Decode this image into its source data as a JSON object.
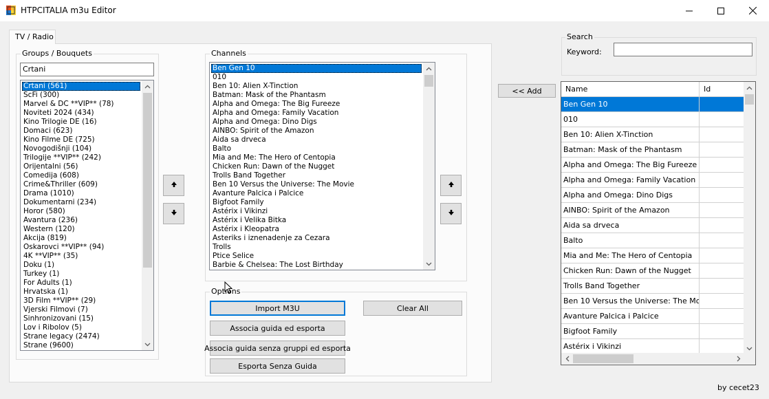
{
  "window": {
    "title": "HTPCITALIA m3u Editor",
    "icon": "app-icon",
    "minimize_glyph": "—",
    "maximize_glyph": "☐",
    "close_glyph": "✕"
  },
  "tab": {
    "label": "TV / Radio"
  },
  "groups": {
    "legend": "Groups / Bouquets",
    "filter_value": "Crtani",
    "selected_index": 0,
    "items": [
      "Crtani (561)",
      "ScFi (300)",
      "Marvel & DC **VIP** (78)",
      "Noviteti 2024 (434)",
      "Kino Trilogie DE (16)",
      "Domaci (623)",
      "Kino Filme DE (725)",
      "Novogodišnji (104)",
      "Trilogije **VIP** (242)",
      "Orijentalni (56)",
      "Comedija (608)",
      "Crime&Thriller (609)",
      "Drama (1010)",
      "Dokumentarni (234)",
      "Horor (580)",
      "Avantura (236)",
      "Western (120)",
      "Akcija (819)",
      "Oskarovci **VIP** (94)",
      "4K **VIP** (35)",
      "Doku (1)",
      "Turkey (1)",
      "For Adults (1)",
      "Hrvatska (1)",
      "3D Film **VIP** (29)",
      "Vjerski Filmovi (7)",
      "Sinhronizovani (15)",
      "Lov i Ribolov (5)",
      "Strane legacy (2474)",
      "Strane (9600)"
    ]
  },
  "channels": {
    "legend": "Channels",
    "selected_index": 0,
    "items": [
      "Ben Gen 10",
      "010",
      "Ben 10: Alien X-Tinction",
      "Batman: Mask of the Phantasm",
      "Alpha and Omega: The Big Fureeze",
      "Alpha and Omega: Family Vacation",
      "Alpha and Omega: Dino Digs",
      "AINBO: Spirit of the Amazon",
      "Aida sa drveca",
      "Balto",
      "Mia and Me: The Hero of Centopia",
      "Chicken Run: Dawn of the Nugget",
      "Trolls Band Together",
      "Ben 10 Versus the Universe: The Movie",
      "Avanture Palcica i Palcice",
      "Bigfoot Family",
      "Astérix i Vikinzi",
      "Astérix i Velika Bitka",
      "Astérix i  Kleopatra",
      "Asteriks i iznenadenje za Cezara",
      "Trolls",
      "Ptice Selice",
      "Barbie & Chelsea: The Lost Birthday"
    ]
  },
  "move_buttons": {
    "up_glyph": "🡅",
    "down_glyph": "🡇"
  },
  "options": {
    "legend": "Options",
    "import_label": "Import M3U",
    "clear_label": "Clear All",
    "assoc_export_label": "Associa guida ed esporta",
    "assoc_nogroups_label": "Associa guida senza gruppi ed esporta",
    "export_noguide_label": "Esporta Senza Guida"
  },
  "search": {
    "legend": "Search",
    "keyword_label": "Keyword:",
    "keyword_value": ""
  },
  "add_button": {
    "label": "<< Add"
  },
  "grid": {
    "columns": [
      "Name",
      "Id"
    ],
    "selected_index": 0,
    "rows": [
      "Ben Gen 10",
      "010",
      "Ben 10: Alien X-Tinction",
      "Batman: Mask of the Phantasm",
      "Alpha and Omega: The Big Fureeze",
      "Alpha and Omega: Family Vacation",
      "Alpha and Omega: Dino Digs",
      "AINBO: Spirit of the Amazon",
      "Aida sa drveca",
      "Balto",
      "Mia and Me: The Hero of Centopia",
      "Chicken Run: Dawn of the Nugget",
      "Trolls Band Together",
      "Ben 10 Versus the Universe: The Movie",
      "Avanture Palcica i Palcice",
      "Bigfoot Family",
      "Astérix i Vikinzi"
    ]
  },
  "footer": {
    "credit": "by cecet23"
  },
  "colors": {
    "selection": "#0078d7",
    "window_bg": "#f0f0f0",
    "tab_bg": "#fbfbfb"
  }
}
